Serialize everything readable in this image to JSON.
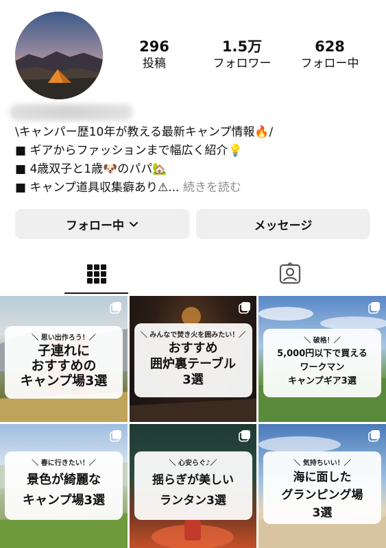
{
  "profile": {
    "stats": [
      {
        "value": "296",
        "label": "投稿"
      },
      {
        "value": "1.5万",
        "label": "フォロワー"
      },
      {
        "value": "628",
        "label": "フォロー中"
      }
    ],
    "bio_lines": [
      "\\キャンパー歴10年が教える最新キャンプ情報🔥/",
      "■ ギアからファッションまで幅広く紹介💡",
      "■ 4歳双子と1歳🐶のパパ🏡",
      "■ キャンプ道具収集癖あり⚠..."
    ],
    "more_label": "続きを読む"
  },
  "buttons": {
    "following": "フォロー中",
    "message": "メッセージ"
  },
  "tabs": {
    "posts_icon": "grid-icon",
    "tagged_icon": "tagged-person-icon"
  },
  "posts": [
    {
      "tag": "＼ 思い出作ろう！／",
      "title": "子連れに\nおすすめの\nキャンプ場3選"
    },
    {
      "tag": "＼ みんなで焚き火を囲みたい！／",
      "title": "おすすめ\n囲炉裏テーブル\n3選"
    },
    {
      "tag": "＼ 破格！／",
      "title": "5,000円以下で買える\nワークマン\nキャンプギア3選"
    },
    {
      "tag": "＼ 春に行きたい！／",
      "title": "景色が綺麗な\nキャンプ場3選"
    },
    {
      "tag": "＼ 心安らぐ♪／",
      "title": "揺らぎが美しい\nランタン3選"
    },
    {
      "tag": "＼ 気持ちいい！／",
      "title": "海に面した\nグランピング場\n3選"
    }
  ],
  "colors": {
    "button_bg": "#efefef",
    "text": "#111111",
    "muted": "#8e8e8e"
  }
}
